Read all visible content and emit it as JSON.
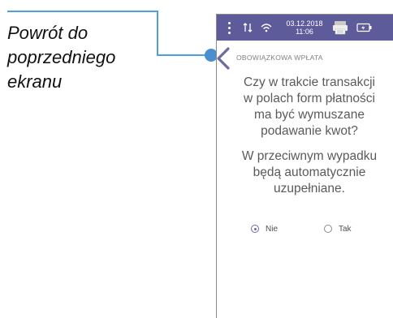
{
  "annotation": {
    "line1": "Powrót do",
    "line2": "poprzedniego",
    "line3": "ekranu"
  },
  "status_bar": {
    "date": "03.12.2018",
    "time": "11:06",
    "background_color": "#5e5b9b",
    "icons": [
      "menu-dots-icon",
      "signal-icon",
      "wifi-icon",
      "printer-icon",
      "battery-icon"
    ]
  },
  "screen": {
    "title": "OBOWIĄZKOWA WPŁATA",
    "question_lines": [
      "Czy w trakcie transakcji",
      "w polach form płatności",
      "ma być wymuszane",
      "podawanie kwot?"
    ],
    "info_lines": [
      "W przeciwnym wypadku",
      "będą automatycznie",
      "uzupełniane."
    ]
  },
  "options": [
    {
      "label": "Nie",
      "selected": true
    },
    {
      "label": "Tak",
      "selected": false
    }
  ],
  "colors": {
    "accent": "#6d6a9f",
    "annotation_line": "#4ea0dc",
    "annotation_dot": "#4b8fd0"
  }
}
